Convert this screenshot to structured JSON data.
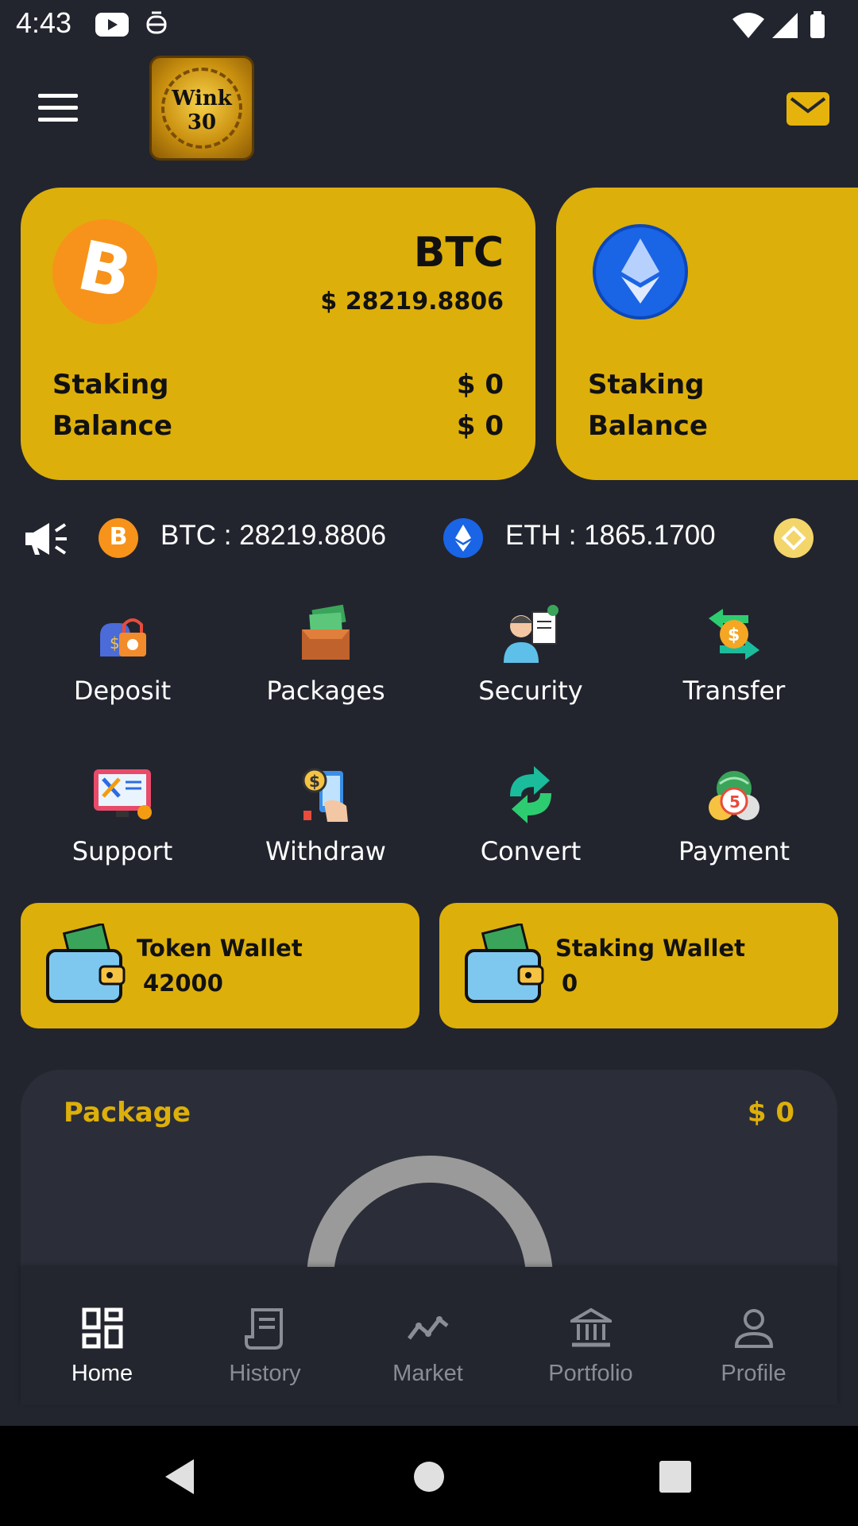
{
  "status_bar": {
    "time": "4:43"
  },
  "header": {
    "logo_text": "Wink 30"
  },
  "cards": [
    {
      "symbol": "BTC",
      "price": "$ 28219.8806",
      "staking_label": "Staking",
      "balance_label": "Balance",
      "staking_value": "$ 0",
      "balance_value": "$ 0"
    },
    {
      "symbol": "",
      "staking_label": "Staking",
      "balance_label": "Balance"
    }
  ],
  "ticker": [
    {
      "text": "BTC : 28219.8806",
      "icon": "bitcoin-icon",
      "color": "#f7931a"
    },
    {
      "text": "ETH : 1865.1700",
      "icon": "ethereum-icon",
      "color": "#1a64e6"
    },
    {
      "text": "",
      "icon": "binance-icon",
      "color": "#f3d56a"
    }
  ],
  "features": [
    {
      "label": "Deposit",
      "icon": "deposit-money-bag-icon"
    },
    {
      "label": "Packages",
      "icon": "packages-box-icon"
    },
    {
      "label": "Security",
      "icon": "security-person-icon"
    },
    {
      "label": "Transfer",
      "icon": "transfer-arrows-icon"
    },
    {
      "label": "Support",
      "icon": "support-tools-icon"
    },
    {
      "label": "Withdraw",
      "icon": "withdraw-phone-icon"
    },
    {
      "label": "Convert",
      "icon": "convert-arrows-icon"
    },
    {
      "label": "Payment",
      "icon": "payment-globe-icon"
    }
  ],
  "wallets": [
    {
      "title": "Token Wallet",
      "value": "42000"
    },
    {
      "title": "Staking Wallet",
      "value": "0"
    }
  ],
  "package": {
    "title": "Package",
    "value": "$ 0"
  },
  "bottom_nav": [
    {
      "label": "Home",
      "icon": "home-grid-icon",
      "active": true
    },
    {
      "label": "History",
      "icon": "history-receipt-icon",
      "active": false
    },
    {
      "label": "Market",
      "icon": "market-chart-icon",
      "active": false
    },
    {
      "label": "Portfolio",
      "icon": "portfolio-bank-icon",
      "active": false
    },
    {
      "label": "Profile",
      "icon": "profile-person-icon",
      "active": false
    }
  ],
  "colors": {
    "accent": "#ddaf0b",
    "background": "#22252e",
    "panel": "#2b2e38"
  }
}
